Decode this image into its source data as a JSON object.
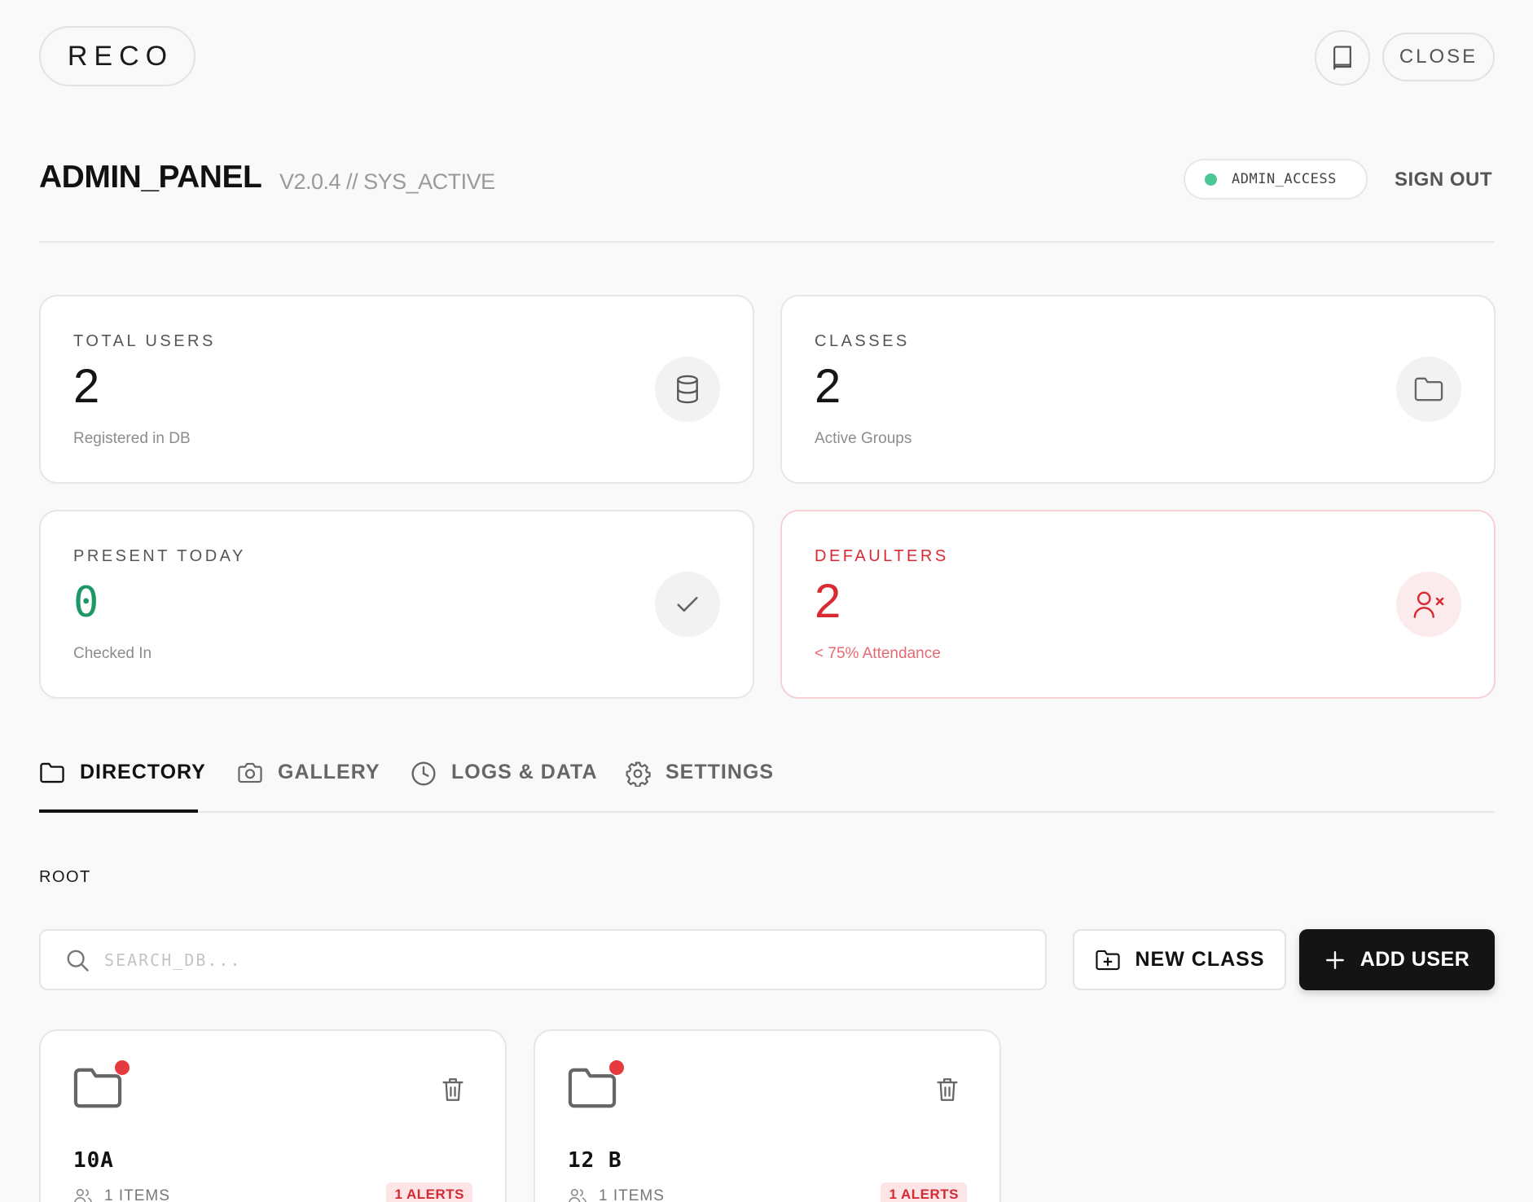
{
  "topbar": {
    "logo": "RECO",
    "close_label": "CLOSE",
    "book_icon": "book-icon"
  },
  "header": {
    "title": "ADMIN_PANEL",
    "version": "V2.0.4 // SYS_ACTIVE",
    "access_badge": "ADMIN_ACCESS",
    "access_status_color": "#49c794",
    "signout_label": "SIGN OUT"
  },
  "stats": [
    {
      "label": "TOTAL USERS",
      "value": "2",
      "sub": "Registered in DB",
      "icon": "database-icon"
    },
    {
      "label": "CLASSES",
      "value": "2",
      "sub": "Active Groups",
      "icon": "folder-icon"
    },
    {
      "label": "PRESENT TODAY",
      "value": "0",
      "sub": "Checked In",
      "icon": "check-icon",
      "accent": "#1c9867"
    },
    {
      "label": "DEFAULTERS",
      "value": "2",
      "sub": "< 75% Attendance",
      "icon": "user-x-icon",
      "accent": "#d92a33"
    }
  ],
  "tabs": [
    {
      "label": "DIRECTORY",
      "icon": "folder-icon",
      "active": true
    },
    {
      "label": "GALLERY",
      "icon": "camera-icon",
      "active": false
    },
    {
      "label": "LOGS & DATA",
      "icon": "clock-icon",
      "active": false
    },
    {
      "label": "SETTINGS",
      "icon": "gear-icon",
      "active": false
    }
  ],
  "breadcrumb": "ROOT",
  "toolbar": {
    "search_placeholder": "SEARCH_DB...",
    "search_value": "",
    "new_class_label": "NEW CLASS",
    "add_user_label": "ADD USER"
  },
  "classes": [
    {
      "name": "10A",
      "items": "1 ITEMS",
      "alerts": "1 ALERTS"
    },
    {
      "name": "12 B",
      "items": "1 ITEMS",
      "alerts": "1 ALERTS"
    }
  ]
}
